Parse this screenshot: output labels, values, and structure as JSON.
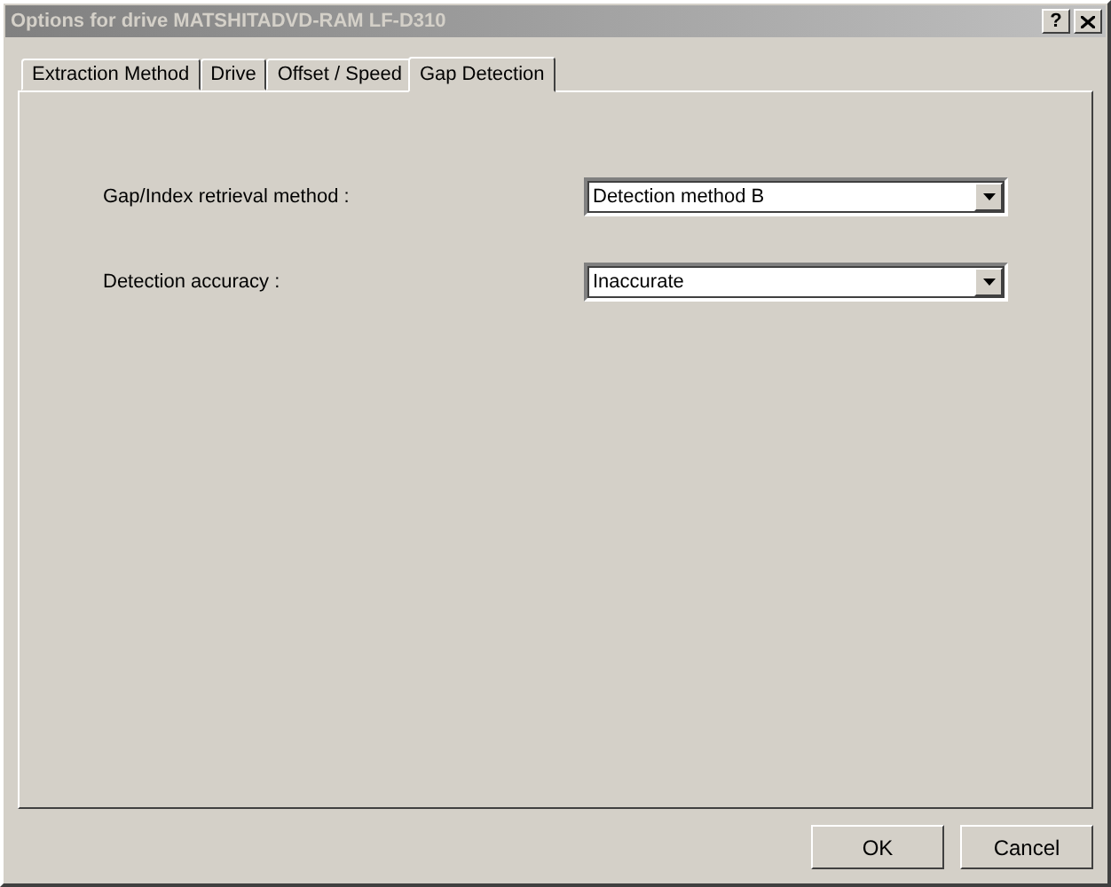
{
  "window": {
    "title": "Options for drive MATSHITADVD-RAM LF-D310",
    "active": false,
    "help_button": "?"
  },
  "tabs": [
    {
      "label": "Extraction Method",
      "selected": false
    },
    {
      "label": "Drive",
      "selected": false
    },
    {
      "label": "Offset / Speed",
      "selected": false
    },
    {
      "label": "Gap Detection",
      "selected": true
    }
  ],
  "fields": [
    {
      "label": "Gap/Index retrieval method :",
      "value": "Detection method B"
    },
    {
      "label": "Detection accuracy :",
      "value": "Inaccurate"
    }
  ],
  "buttons": [
    "OK",
    "Cancel"
  ]
}
